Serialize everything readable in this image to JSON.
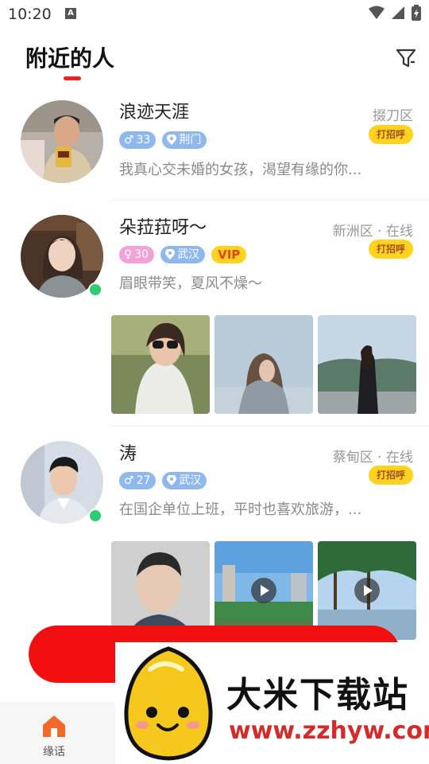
{
  "status_bar": {
    "time": "10:20"
  },
  "header": {
    "title": "附近的人"
  },
  "users": [
    {
      "name": "浪迹天涯",
      "location": "掇刀区",
      "greet_label": "打招呼",
      "gender": "male",
      "age": "33",
      "city": "荆门",
      "bio": "我真心交未婚的女孩，渴望有缘的你...",
      "online": false
    },
    {
      "name": "朵菈菈呀～",
      "location": "新洲区 · 在线",
      "greet_label": "打招呼",
      "gender": "female",
      "age": "30",
      "city": "武汉",
      "vip_label": "VIP",
      "bio": "眉眼带笑，夏风不燥～",
      "online": true
    },
    {
      "name": "涛",
      "location": "蔡甸区 · 在线",
      "greet_label": "打招呼",
      "gender": "male",
      "age": "27",
      "city": "武汉",
      "bio": "在国企单位上班，平时也喜欢旅游，...",
      "online": true
    }
  ],
  "tab_bar": {
    "home_label": "缘话"
  },
  "watermark": {
    "title": "大米下载站",
    "url": "www.zzhyw.com"
  },
  "colors": {
    "accent": "#ee2222",
    "greet": "#ffd21f",
    "online": "#2ecc71"
  }
}
